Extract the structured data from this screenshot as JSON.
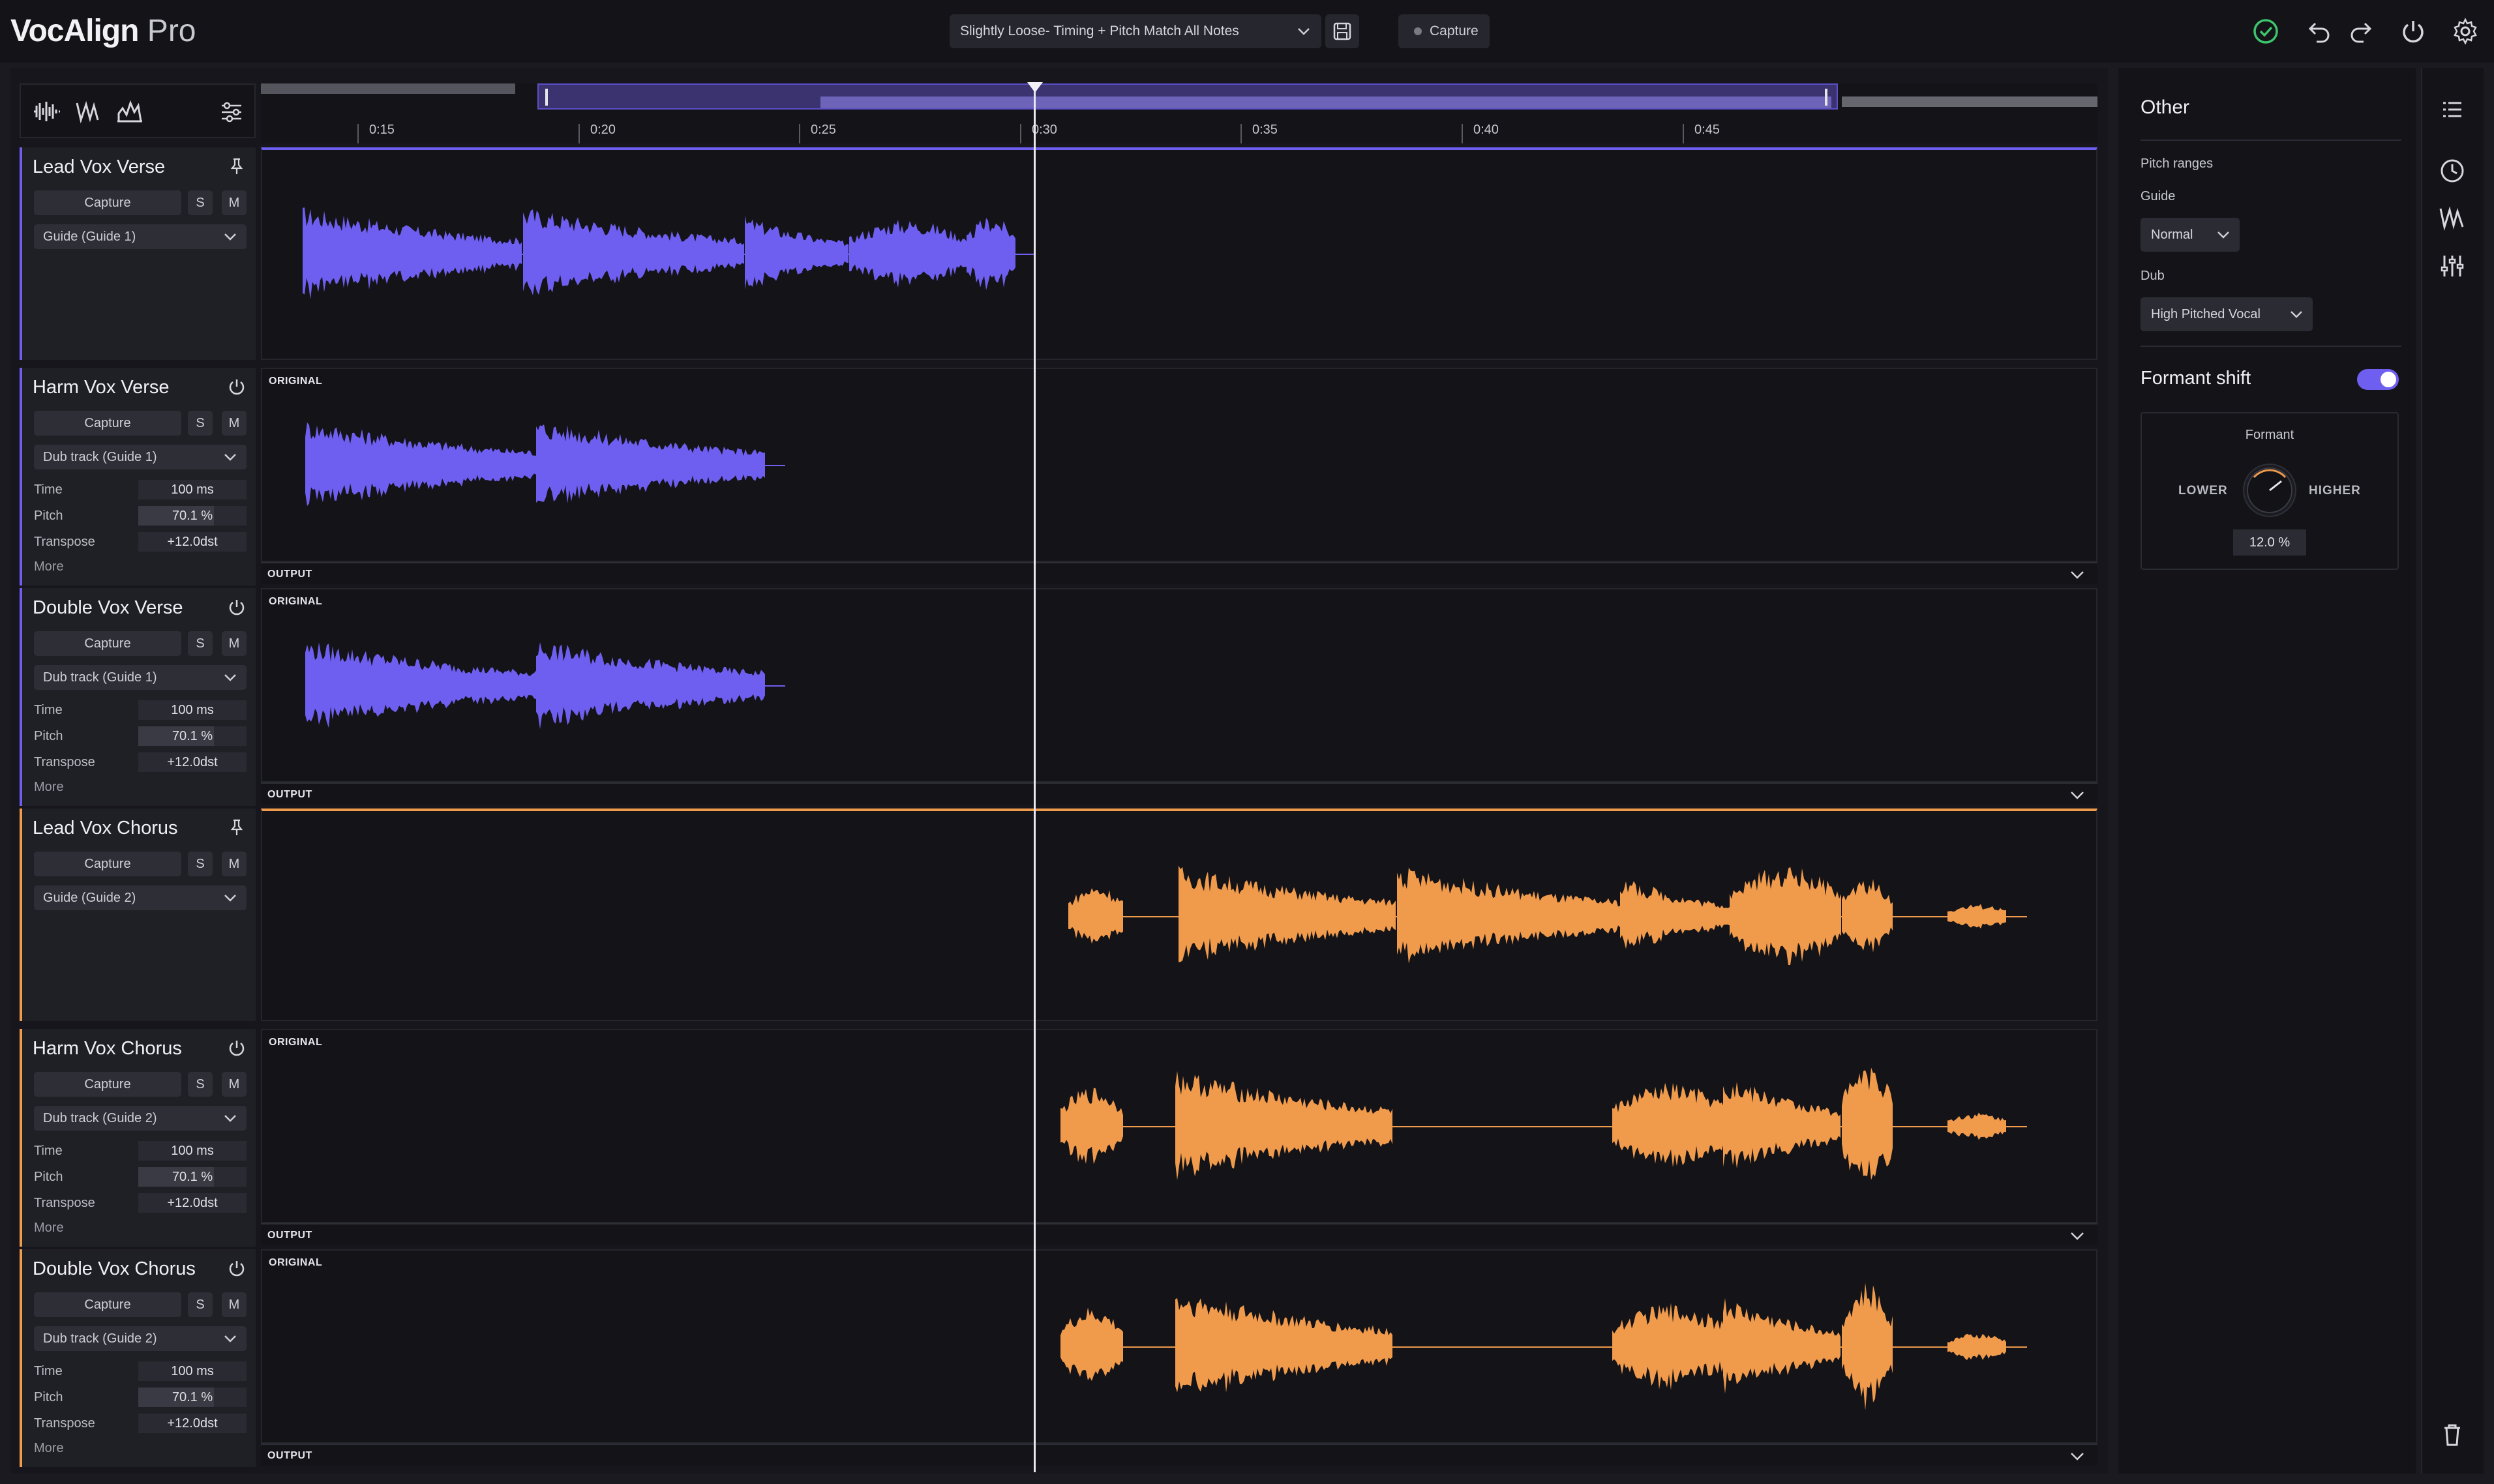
{
  "app": {
    "name_bold": "VocAlign",
    "name_light": "Pro"
  },
  "toolbar": {
    "preset": "Slightly Loose- Timing + Pitch Match All Notes",
    "capture": "Capture"
  },
  "ruler": {
    "ticks": [
      "0:15",
      "0:20",
      "0:25",
      "0:30",
      "0:35",
      "0:40",
      "0:45"
    ]
  },
  "colors": {
    "purple": "#6f5ff0",
    "orange": "#f09a4c",
    "status_ok": "#3ec46d"
  },
  "tracks": [
    {
      "name": "Lead Vox Verse",
      "type": "guide",
      "capture": "Capture",
      "solo": "S",
      "mute": "M",
      "guide": "Guide (Guide 1)"
    },
    {
      "name": "Harm Vox Verse",
      "type": "dub",
      "capture": "Capture",
      "solo": "S",
      "mute": "M",
      "guide": "Dub track (Guide 1)",
      "time_label": "Time",
      "time": "100 ms",
      "pitch_label": "Pitch",
      "pitch": "70.1 %",
      "pitch_level": 0.701,
      "transpose_label": "Transpose",
      "transpose": "+12.0dst",
      "more": "More",
      "original": "ORIGINAL",
      "output": "OUTPUT"
    },
    {
      "name": "Double Vox Verse",
      "type": "dub",
      "capture": "Capture",
      "solo": "S",
      "mute": "M",
      "guide": "Dub track (Guide 1)",
      "time_label": "Time",
      "time": "100 ms",
      "pitch_label": "Pitch",
      "pitch": "70.1 %",
      "pitch_level": 0.701,
      "transpose_label": "Transpose",
      "transpose": "+12.0dst",
      "more": "More",
      "original": "ORIGINAL",
      "output": "OUTPUT"
    },
    {
      "name": "Lead Vox Chorus",
      "type": "guide",
      "capture": "Capture",
      "solo": "S",
      "mute": "M",
      "guide": "Guide (Guide 2)"
    },
    {
      "name": "Harm Vox Chorus",
      "type": "dub",
      "capture": "Capture",
      "solo": "S",
      "mute": "M",
      "guide": "Dub track (Guide 2)",
      "time_label": "Time",
      "time": "100 ms",
      "pitch_label": "Pitch",
      "pitch": "70.1 %",
      "pitch_level": 0.701,
      "transpose_label": "Transpose",
      "transpose": "+12.0dst",
      "more": "More",
      "original": "ORIGINAL",
      "output": "OUTPUT"
    },
    {
      "name": "Double Vox Chorus",
      "type": "dub",
      "capture": "Capture",
      "solo": "S",
      "mute": "M",
      "guide": "Dub track (Guide 2)",
      "time_label": "Time",
      "time": "100 ms",
      "pitch_label": "Pitch",
      "pitch": "70.1 %",
      "pitch_level": 0.701,
      "transpose_label": "Transpose",
      "transpose": "+12.0dst",
      "more": "More",
      "original": "ORIGINAL",
      "output": "OUTPUT"
    }
  ],
  "panel": {
    "title": "Other",
    "pitch_ranges": "Pitch ranges",
    "guide_label": "Guide",
    "guide_value": "Normal",
    "dub_label": "Dub",
    "dub_value": "High Pitched Vocal",
    "formant_shift": "Formant shift",
    "formant_shift_on": true,
    "formant_title": "Formant",
    "lower": "LOWER",
    "higher": "HIGHER",
    "formant_value": "12.0 %"
  },
  "icons": {
    "top": [
      "status-ok-icon",
      "undo-icon",
      "redo-icon",
      "power-icon",
      "settings-gear-icon"
    ],
    "tools": [
      "waveform-icon",
      "pitch-curve-icon",
      "histogram-icon",
      "sliders-icon"
    ],
    "side": [
      "list-icon",
      "clock-icon",
      "pitch-icon",
      "mixer-icon",
      "trash-icon"
    ]
  }
}
